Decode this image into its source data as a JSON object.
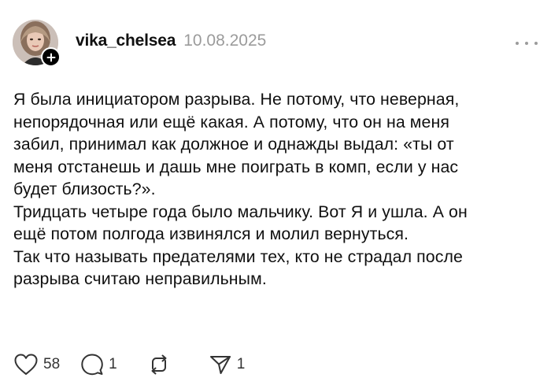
{
  "post": {
    "username": "vika_chelsea",
    "date": "10.08.2025",
    "more_icon": "more-horizontal-icon",
    "follow_icon": "plus-icon",
    "body_lines": [
      "Я была инициатором разрыва. Не потому, что неверная,",
      "непорядочная или ещё какая. А потому, что он на меня",
      "забил, принимал как должное и однажды выдал: «ты от",
      "меня отстанешь и дашь мне поиграть в комп, если у нас",
      "будет близость?».",
      "Тридцать четыре года было мальчику. Вот Я и ушла. А он",
      "ещё потом полгода извинялся и молил вернуться.",
      "Так что называть предателями тех, кто не страдал после",
      "разрыва считаю неправильным."
    ]
  },
  "actions": {
    "like": {
      "icon": "heart-icon",
      "count": "58"
    },
    "reply": {
      "icon": "comment-icon",
      "count": "1"
    },
    "repost": {
      "icon": "repost-icon",
      "count": ""
    },
    "share": {
      "icon": "send-icon",
      "count": "1"
    }
  },
  "colors": {
    "text": "#101010",
    "muted": "#9b9b9b",
    "badge": "#000000",
    "background": "#ffffff"
  }
}
